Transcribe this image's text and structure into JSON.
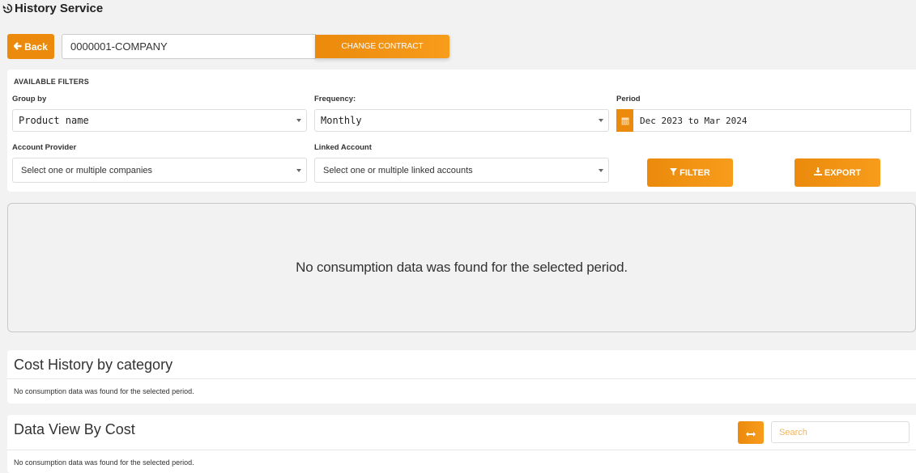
{
  "header": {
    "title": "History Service",
    "title_icon": "history-icon"
  },
  "contract": {
    "back_label": "Back",
    "back_icon": "arrow-left-icon",
    "value": "0000001-COMPANY",
    "change_label": "CHANGE CONTRACT"
  },
  "filters": {
    "heading": "AVAILABLE FILTERS",
    "group_by": {
      "label": "Group by",
      "value": "Product name"
    },
    "frequency": {
      "label": "Frequency:",
      "value": "Monthly"
    },
    "period": {
      "label": "Period",
      "value": "Dec 2023 to Mar 2024",
      "icon": "calendar-icon"
    },
    "account_provider": {
      "label": "Account Provider",
      "placeholder": "Select one or multiple companies"
    },
    "linked_account": {
      "label": "Linked Account",
      "placeholder": "Select one or multiple linked accounts"
    },
    "filter_label": "FILTER",
    "filter_icon": "filter-icon",
    "export_label": "EXPORT",
    "export_icon": "download-icon"
  },
  "chart_area": {
    "message": "No consumption data was found for the selected period."
  },
  "cost_history": {
    "title": "Cost History by category",
    "message": "No consumption data was found for the selected period."
  },
  "data_view": {
    "title": "Data View By Cost",
    "search_placeholder": "Search",
    "swap_icon": "swap-horizontal-icon",
    "message": "No consumption data was found for the selected period."
  },
  "colors": {
    "accent": "#eb8a0c",
    "accent_light": "#f89c1c",
    "background": "#f2f2f2"
  }
}
